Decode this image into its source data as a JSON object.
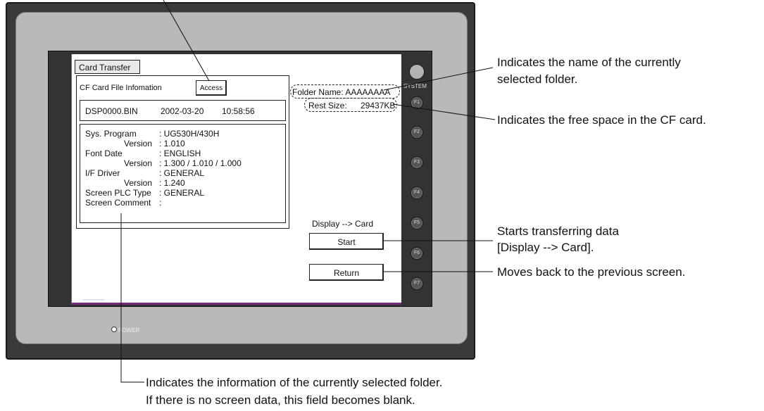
{
  "screen": {
    "title": "Card Transfer",
    "info_header": "CF Card File Infomation",
    "access_button": "Access",
    "file": {
      "name": "DSP0000.BIN",
      "date": "2002-03-20",
      "time": "10:58:56"
    },
    "details": [
      {
        "label": "Sys. Program",
        "value": ": UG530H/430H"
      },
      {
        "label": "Version",
        "value": ": 1.010"
      },
      {
        "label": "Font Date",
        "value": ": ENGLISH"
      },
      {
        "label": "Version",
        "value": ": 1.300 / 1.010 / 1.000"
      },
      {
        "label": "I/F Driver",
        "value": ": GENERAL"
      },
      {
        "label": "Version",
        "value": ": 1.240"
      },
      {
        "label": "Screen PLC Type",
        "value": ": GENERAL"
      },
      {
        "label": "Screen Comment",
        "value": ":"
      }
    ],
    "folder_name": "Folder Name: AAAAAAAA",
    "rest_size_label": "Rest Size:",
    "rest_size_value": "29437KB",
    "direction": "Display --> Card",
    "start_button": "Start",
    "return_button": "Return"
  },
  "device": {
    "system_label": "SYSTEM",
    "function_keys": [
      "F1",
      "F2",
      "F3",
      "F4",
      "F5",
      "F6",
      "F7"
    ],
    "power_label": "POWER"
  },
  "annotations": {
    "folder_name": [
      "Indicates the name of the currently",
      "selected folder."
    ],
    "free_space": "Indicates the free space in the CF card.",
    "start": [
      "Starts transferring data",
      "[Display --> Card]."
    ],
    "return": "Moves back to the previous screen.",
    "info": [
      "Indicates the information of the currently selected folder.",
      "If there is no screen data, this field becomes blank."
    ]
  }
}
